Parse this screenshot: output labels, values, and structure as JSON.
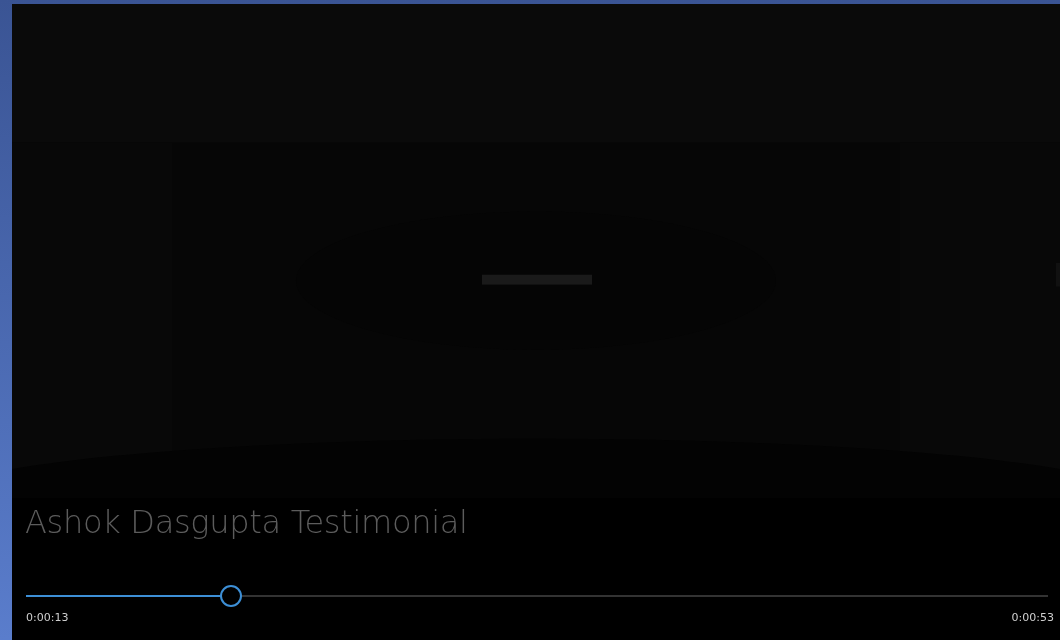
{
  "title": "Ashok Dasgupta Testimonial",
  "seek_bar": {
    "level": 0.205
  },
  "elapsed": "0:00:13",
  "duration": "0:00:53"
}
